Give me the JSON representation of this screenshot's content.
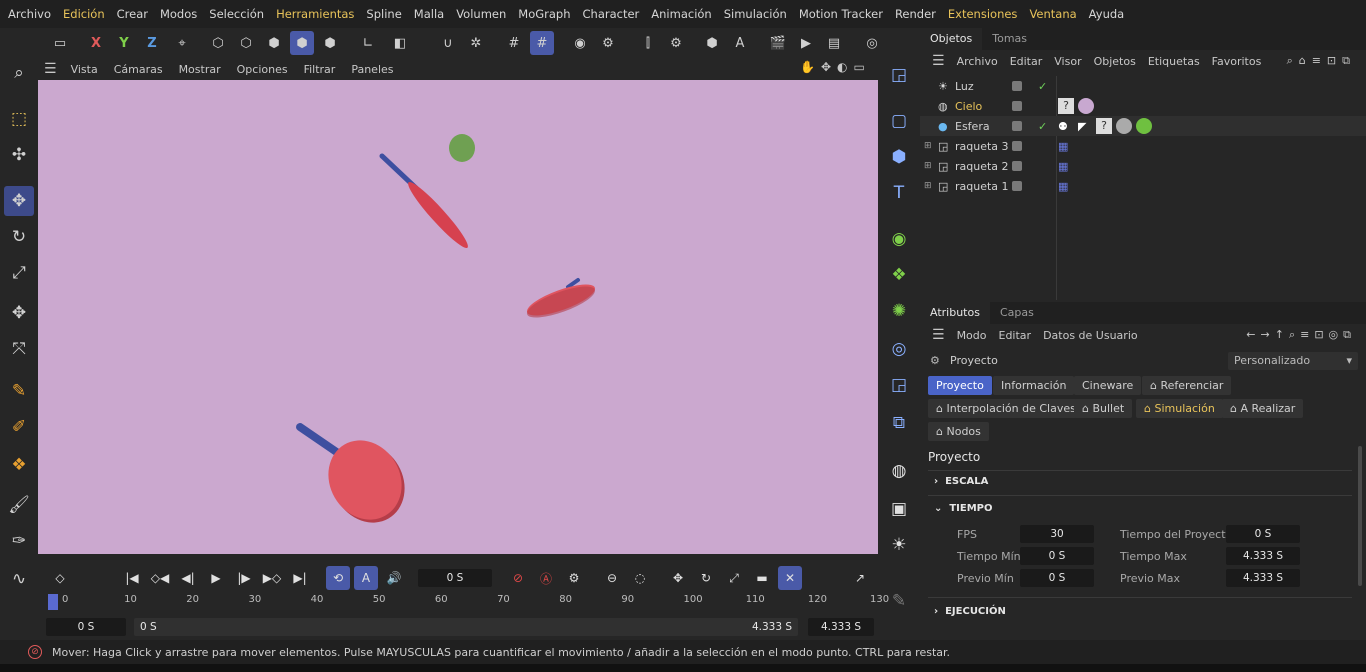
{
  "menu": [
    "Archivo",
    "Edición",
    "Crear",
    "Modos",
    "Selección",
    "Herramientas",
    "Spline",
    "Malla",
    "Volumen",
    "MoGraph",
    "Character",
    "Animación",
    "Simulación",
    "Motion Tracker",
    "Render",
    "Extensiones",
    "Ventana",
    "Ayuda"
  ],
  "menu_highlight": [
    "Edición",
    "Herramientas",
    "Extensiones",
    "Ventana"
  ],
  "toolbar": {
    "x": "X",
    "y": "Y",
    "z": "Z"
  },
  "viewport_menu": [
    "Vista",
    "Cámaras",
    "Mostrar",
    "Opciones",
    "Filtrar",
    "Paneles"
  ],
  "scene": {
    "background": "#cba8cf",
    "paddle_color": "#e05560",
    "handle_color": "#3e4fa0",
    "ball_color": "#6fa052"
  },
  "timeline": {
    "current_time": "0 S",
    "ruler_ticks": [
      "0",
      "10",
      "20",
      "30",
      "40",
      "50",
      "60",
      "70",
      "80",
      "90",
      "100",
      "110",
      "120",
      "130"
    ],
    "start": "0 S",
    "range_start": "0 S",
    "range_end": "4.333 S",
    "end": "4.333 S"
  },
  "objects_panel": {
    "tabs": [
      "Objetos",
      "Tomas"
    ],
    "menu": [
      "Archivo",
      "Editar",
      "Visor",
      "Objetos",
      "Etiquetas",
      "Favoritos"
    ],
    "items": [
      {
        "name": "Luz"
      },
      {
        "name": "Cielo"
      },
      {
        "name": "Esfera"
      },
      {
        "name": "raqueta 3"
      },
      {
        "name": "raqueta 2"
      },
      {
        "name": "raqueta 1"
      }
    ]
  },
  "attributes_panel": {
    "tabs": [
      "Atributos",
      "Capas"
    ],
    "menu": [
      "Modo",
      "Editar",
      "Datos de Usuario"
    ],
    "object_label": "Proyecto",
    "preset": "Personalizado",
    "buttons_row1": [
      "Proyecto",
      "Información",
      "Cineware",
      "Referenciar"
    ],
    "buttons_row2": [
      "Interpolación de Claves",
      "Bullet",
      "Simulación",
      "A Realizar"
    ],
    "buttons_row3": [
      "Nodos"
    ],
    "section_title": "Proyecto",
    "group_escala": "ESCALA",
    "group_tiempo": "TIEMPO",
    "group_ejecucion": "EJECUCIÓN",
    "fields": {
      "fps_label": "FPS",
      "fps": "30",
      "tproj_label": "Tiempo del Proyecto",
      "tproj": "0 S",
      "tmin_label": "Tiempo Mín",
      "tmin": "0 S",
      "tmax_label": "Tiempo Max",
      "tmax": "4.333 S",
      "pmin_label": "Previo Mín",
      "pmin": "0 S",
      "pmax_label": "Previo Max",
      "pmax": "4.333 S"
    }
  },
  "status": "Mover: Haga Click y arrastre para mover elementos. Pulse MAYUSCULAS para cuantificar el movimiento / añadir a la selección en el modo punto. CTRL para restar."
}
